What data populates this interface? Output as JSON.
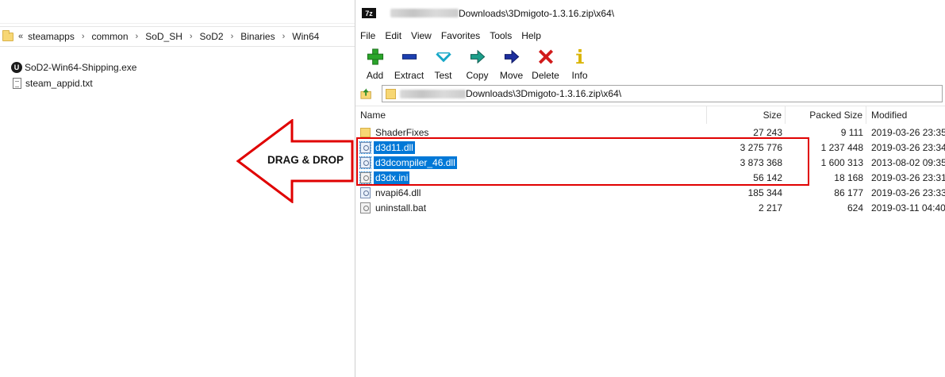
{
  "explorer": {
    "breadcrumb_overflow": "«",
    "breadcrumb": [
      "steamapps",
      "common",
      "SoD_SH",
      "SoD2",
      "Binaries",
      "Win64"
    ],
    "breadcrumb_sep": "›",
    "files": [
      {
        "name": "SoD2-Win64-Shipping.exe",
        "icon": "unreal-engine-icon"
      },
      {
        "name": "steam_appid.txt",
        "icon": "text-file-icon"
      }
    ]
  },
  "annotation": {
    "arrow_label": "DRAG & DROP",
    "arrow_color": "#e00000",
    "box_color": "#e00000"
  },
  "zip": {
    "logo": "7z",
    "title": "Downloads\\3Dmigoto-1.3.16.zip\\x64\\",
    "menu": [
      "File",
      "Edit",
      "View",
      "Favorites",
      "Tools",
      "Help"
    ],
    "toolbar": [
      {
        "label": "Add",
        "icon": "add-icon"
      },
      {
        "label": "Extract",
        "icon": "extract-icon"
      },
      {
        "label": "Test",
        "icon": "test-icon"
      },
      {
        "label": "Copy",
        "icon": "copy-icon"
      },
      {
        "label": "Move",
        "icon": "move-icon"
      },
      {
        "label": "Delete",
        "icon": "delete-icon"
      },
      {
        "label": "Info",
        "icon": "info-icon"
      }
    ],
    "path": "Downloads\\3Dmigoto-1.3.16.zip\\x64\\",
    "columns": {
      "name": "Name",
      "size": "Size",
      "packed": "Packed Size",
      "modified": "Modified"
    },
    "rows": [
      {
        "name": "ShaderFixes",
        "size": "27 243",
        "packed": "9 111",
        "modified": "2019-03-26 23:35",
        "type": "folder",
        "selected": false
      },
      {
        "name": "d3d11.dll",
        "size": "3 275 776",
        "packed": "1 237 448",
        "modified": "2019-03-26 23:34",
        "type": "dll",
        "selected": true
      },
      {
        "name": "d3dcompiler_46.dll",
        "size": "3 873 368",
        "packed": "1 600 313",
        "modified": "2013-08-02 09:35",
        "type": "dll",
        "selected": true
      },
      {
        "name": "d3dx.ini",
        "size": "56 142",
        "packed": "18 168",
        "modified": "2019-03-26 23:31",
        "type": "ini",
        "selected": true
      },
      {
        "name": "nvapi64.dll",
        "size": "185 344",
        "packed": "86 177",
        "modified": "2019-03-26 23:33",
        "type": "dll",
        "selected": false
      },
      {
        "name": "uninstall.bat",
        "size": "2 217",
        "packed": "624",
        "modified": "2019-03-11 04:40",
        "type": "bat",
        "selected": false
      }
    ],
    "selection_color": "#0078d7"
  }
}
